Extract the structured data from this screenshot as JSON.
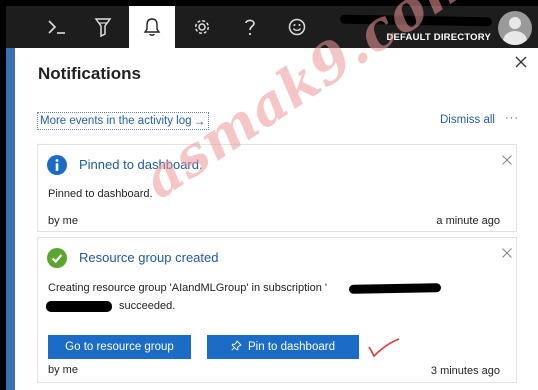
{
  "topbar": {
    "icons": [
      "cloud-shell-icon",
      "directory-filter-icon",
      "bell-icon",
      "gear-icon",
      "help-icon",
      "smiley-icon",
      "avatar-icon"
    ],
    "directory_label": "DEFAULT DIRECTORY"
  },
  "panel": {
    "title": "Notifications",
    "activity_link": "More events in the activity log",
    "dismiss_all": "Dismiss all",
    "more": "···"
  },
  "notifications": [
    {
      "status": "info",
      "title": "Pinned to dashboard.",
      "body": "Pinned to dashboard.",
      "by": "by me",
      "time": "a minute ago"
    },
    {
      "status": "success",
      "title": "Resource group created",
      "body": "Creating resource group 'AIandMLGroup' in subscription '",
      "body_end": "succeeded.",
      "actions": [
        "Go to resource group",
        "Pin to dashboard"
      ],
      "by": "by me",
      "time": "3 minutes ago"
    }
  ],
  "watermark": "asmak9.com",
  "colors": {
    "topbar": "#1d1d1d",
    "accent_blue": "#1a6cc7",
    "link_blue": "#1f5fb0",
    "info_icon": "#1a6cc7",
    "success_icon": "#5aa62e",
    "annotation_red": "#e23b3b"
  }
}
